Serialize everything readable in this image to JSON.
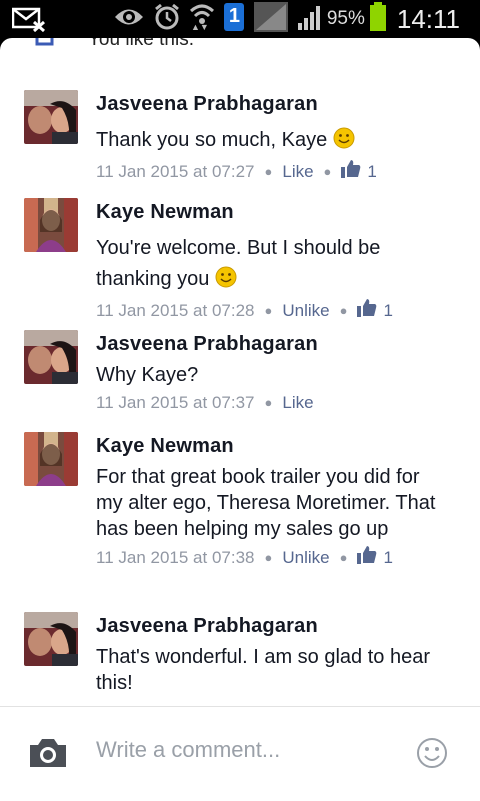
{
  "status_bar": {
    "battery_percent": "95%",
    "time": "14:11",
    "notification_badge": "1",
    "icons": [
      "mail-x-icon",
      "eye-icon",
      "alarm-icon",
      "wifi-icon",
      "badge-icon",
      "no-signal-icon",
      "signal-icon",
      "battery-icon"
    ]
  },
  "top_like": {
    "text": "You like this."
  },
  "comments": [
    {
      "name": "Jasveena Prabhagaran",
      "text": "Thank you so much, Kaye",
      "emoji": "smiley",
      "time": "11 Jan 2015 at 07:27",
      "action": "Like",
      "likes": "1"
    },
    {
      "name": "Kaye Newman",
      "text": "You're welcome. But I should be thanking you",
      "emoji": "smiley",
      "time": "11 Jan 2015 at 07:28",
      "action": "Unlike",
      "likes": "1"
    },
    {
      "name": "Jasveena Prabhagaran",
      "text": "Why Kaye?",
      "time": "11 Jan 2015 at 07:37",
      "action": "Like"
    },
    {
      "name": "Kaye Newman",
      "text": "For that great book trailer you did for my alter ego, Theresa Moretimer. That has been helping my sales go up",
      "time": "11 Jan 2015 at 07:38",
      "action": "Unlike",
      "likes": "1"
    },
    {
      "name": "Jasveena Prabhagaran",
      "text": "That's wonderful. I am so glad to hear this!"
    }
  ],
  "composer": {
    "placeholder": "Write a comment..."
  },
  "colors": {
    "link": "#56678f",
    "meta": "#9197a3",
    "name": "#141823",
    "emoji": "#f5c400"
  }
}
